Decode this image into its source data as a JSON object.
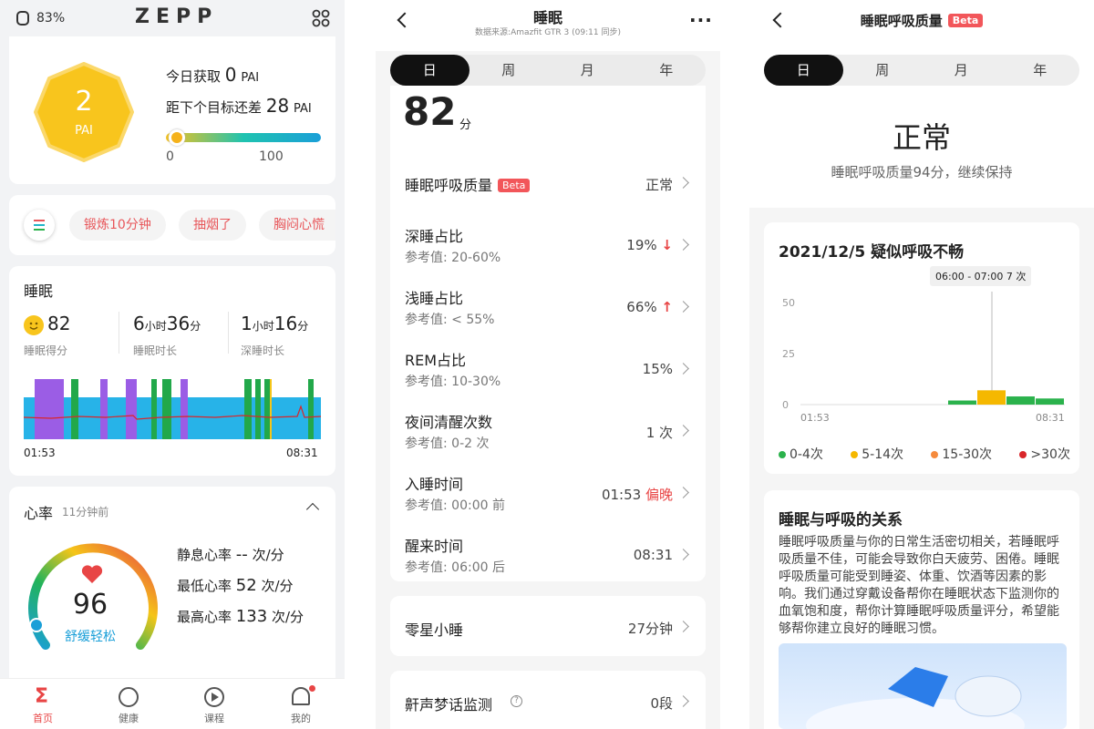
{
  "s1": {
    "status": {
      "battery": "83%",
      "brand": "ZEPP"
    },
    "pai": {
      "value": "2",
      "unit": "PAI",
      "today_label": "今日获取",
      "today_value": "0",
      "today_unit": "PAI",
      "goal_label": "距下个目标还差",
      "goal_value": "28",
      "goal_unit": "PAI",
      "bar_min": "0",
      "bar_max": "100",
      "level": 0.07
    },
    "chips": [
      "锻炼10分钟",
      "抽烟了",
      "胸闷心慌"
    ],
    "sleep": {
      "title": "睡眠",
      "score": "82",
      "score_label": "睡眠得分",
      "dur_h": "6",
      "dur_h_unit": "小时",
      "dur_m": "36",
      "dur_m_unit": "分",
      "dur_label": "睡眠时长",
      "deep_h": "1",
      "deep_h_unit": "小时",
      "deep_m": "16",
      "deep_m_unit": "分",
      "deep_label": "深睡时长",
      "start": "01:53",
      "end": "08:31"
    },
    "hr": {
      "title": "心率",
      "ago": "11分钟前",
      "value": "96",
      "status": "舒缓轻松",
      "rest_label": "静息心率",
      "rest_value": "--",
      "rest_unit": "次/分",
      "min_label": "最低心率",
      "min_value": "52",
      "min_unit": "次/分",
      "max_label": "最高心率",
      "max_value": "133",
      "max_unit": "次/分"
    },
    "nav": [
      "首页",
      "健康",
      "课程",
      "我的"
    ]
  },
  "s2": {
    "title": "睡眠",
    "subtitle": "数据来源:Amazfit GTR 3 (09:11 同步)",
    "tabs": [
      "日",
      "周",
      "月",
      "年"
    ],
    "score": "82",
    "score_unit": "分",
    "rows": [
      {
        "title": "睡眠呼吸质量",
        "beta": "Beta",
        "value": "正常"
      },
      {
        "title": "深睡占比",
        "sub": "参考值: 20-60%",
        "value": "19%",
        "arrow": "↓"
      },
      {
        "title": "浅睡占比",
        "sub": "参考值: < 55%",
        "value": "66%",
        "arrow": "↑"
      },
      {
        "title": "REM占比",
        "sub": "参考值: 10-30%",
        "value": "15%"
      },
      {
        "title": "夜间清醒次数",
        "sub": "参考值: 0-2 次",
        "value": "1 次"
      },
      {
        "title": "入睡时间",
        "sub": "参考值: 00:00 前",
        "value": "01:53",
        "tag": "偏晚"
      },
      {
        "title": "醒来时间",
        "sub": "参考值: 06:00 后",
        "value": "08:31"
      }
    ],
    "nap": {
      "title": "零星小睡",
      "value": "27分钟"
    },
    "snore": {
      "title": "鼾声梦话监测",
      "value": "0段"
    }
  },
  "s3": {
    "title": "睡眠呼吸质量",
    "beta": "Beta",
    "tabs": [
      "日",
      "周",
      "月",
      "年"
    ],
    "status": "正常",
    "desc": "睡眠呼吸质量94分，继续保持",
    "chart_title": "2021/12/5 疑似呼吸不畅",
    "tooltip": "06:00 - 07:00 7 次",
    "chart_data": {
      "type": "bar",
      "yticks": [
        "50",
        "25",
        "0"
      ],
      "ylim": [
        0,
        50
      ],
      "xlabel_start": "01:53",
      "xlabel_end": "08:31",
      "bars": [
        {
          "value": 2,
          "color": "#2bb24c"
        },
        {
          "value": 7,
          "color": "#f5b800"
        },
        {
          "value": 4,
          "color": "#2bb24c"
        },
        {
          "value": 3,
          "color": "#2bb24c"
        }
      ]
    },
    "legend": [
      {
        "label": "0-4次",
        "color": "#2bb24c"
      },
      {
        "label": "5-14次",
        "color": "#f5b800"
      },
      {
        "label": "15-30次",
        "color": "#f58a3c"
      },
      {
        "label": ">30次",
        "color": "#d9262a"
      }
    ],
    "info_title": "睡眠与呼吸的关系",
    "info_text": "睡眠呼吸质量与你的日常生活密切相关，若睡眠呼吸质量不佳，可能会导致你白天疲劳、困倦。睡眠呼吸质量可能受到睡姿、体重、饮酒等因素的影响。我们通过穿戴设备帮你在睡眠状态下监测你的血氧饱和度，帮你计算睡眠呼吸质量评分，希望能够帮你建立良好的睡眠习惯。"
  }
}
